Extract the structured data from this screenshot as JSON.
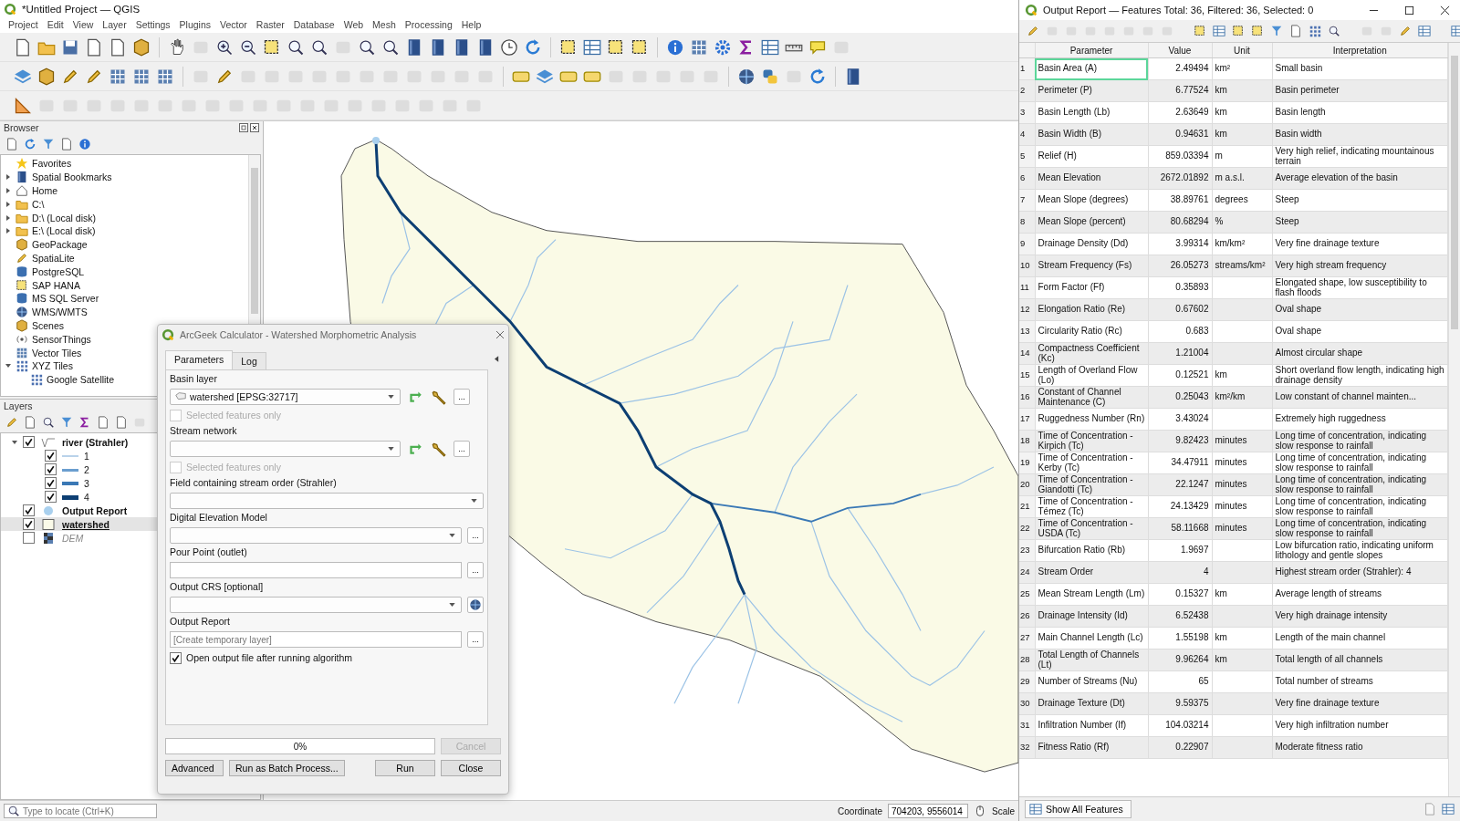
{
  "main_window": {
    "title": "*Untitled Project — QGIS",
    "menu": [
      "Project",
      "Edit",
      "View",
      "Layer",
      "Settings",
      "Plugins",
      "Vector",
      "Raster",
      "Database",
      "Web",
      "Mesh",
      "Processing",
      "Help"
    ]
  },
  "browser": {
    "title": "Browser",
    "items": [
      {
        "label": "Favorites"
      },
      {
        "label": "Spatial Bookmarks",
        "expanded": false
      },
      {
        "label": "Home",
        "expanded": false
      },
      {
        "label": "C:\\",
        "expanded": false
      },
      {
        "label": "D:\\ (Local disk)",
        "expanded": false
      },
      {
        "label": "E:\\ (Local disk)",
        "expanded": false
      },
      {
        "label": "GeoPackage"
      },
      {
        "label": "SpatiaLite"
      },
      {
        "label": "PostgreSQL"
      },
      {
        "label": "SAP HANA"
      },
      {
        "label": "MS SQL Server"
      },
      {
        "label": "WMS/WMTS"
      },
      {
        "label": "Scenes"
      },
      {
        "label": "SensorThings"
      },
      {
        "label": "Vector Tiles"
      },
      {
        "label": "XYZ Tiles",
        "expanded": true,
        "children": [
          {
            "label": "Google Satellite"
          }
        ]
      }
    ]
  },
  "layers": {
    "title": "Layers",
    "items": [
      {
        "label": "river (Strahler)",
        "kind": "line",
        "checked": true,
        "selected": false,
        "expanded": true,
        "children": [
          {
            "label": "1",
            "checked": true,
            "selected": false,
            "color": "#b9d3ea"
          },
          {
            "label": "2",
            "checked": true,
            "selected": false,
            "color": "#6a9ecf"
          },
          {
            "label": "3",
            "checked": true,
            "selected": false,
            "color": "#3a78b5"
          },
          {
            "label": "4",
            "checked": true,
            "selected": false,
            "color": "#0d3f73"
          }
        ]
      },
      {
        "label": "Output Report",
        "kind": "point",
        "checked": true,
        "selected": false
      },
      {
        "label": "watershed",
        "kind": "polygon",
        "checked": true,
        "selected": true
      },
      {
        "label": "DEM",
        "kind": "raster",
        "checked": false,
        "selected": false
      }
    ]
  },
  "dialog": {
    "title": "ArcGeek Calculator - Watershed Morphometric Analysis",
    "tabs": [
      {
        "label": "Parameters",
        "selected": true
      },
      {
        "label": "Log",
        "selected": false
      }
    ],
    "params": [
      {
        "kind": "label",
        "text": "Basin layer"
      },
      {
        "kind": "layer_select",
        "value": "watershed [EPSG:32717]",
        "button": "..."
      },
      {
        "kind": "checkbox",
        "label": "Selected features only",
        "checked": false,
        "disabled": true
      },
      {
        "kind": "label",
        "text": "Stream network"
      },
      {
        "kind": "layer_select",
        "button": "..."
      },
      {
        "kind": "checkbox",
        "label": "Selected features only",
        "checked": false,
        "disabled": true
      },
      {
        "kind": "label",
        "text": "Field containing stream order (Strahler)"
      },
      {
        "kind": "combo"
      },
      {
        "kind": "label",
        "text": "Digital Elevation Model"
      },
      {
        "kind": "combo_browse",
        "button": "..."
      },
      {
        "kind": "label",
        "text": "Pour Point (outlet)"
      },
      {
        "kind": "text_browse",
        "button": "..."
      },
      {
        "kind": "label",
        "text": "Output CRS [optional]"
      },
      {
        "kind": "crs_select"
      },
      {
        "kind": "label",
        "text": "Output Report"
      },
      {
        "kind": "text_browse",
        "placeholder": "[Create temporary layer]",
        "button": "..."
      },
      {
        "kind": "checkbox",
        "label": "Open output file after running algorithm",
        "checked": true,
        "disabled": false
      }
    ],
    "progress": {
      "text": "0%",
      "level": 0
    },
    "cancel": {
      "label": "Cancel",
      "disabled": true
    },
    "buttons": [
      {
        "label": "Advanced",
        "kind": "menu"
      },
      {
        "label": "Run as Batch Process...",
        "kind": "plain"
      },
      {
        "label": "Run",
        "kind": "plain"
      },
      {
        "label": "Close",
        "kind": "plain"
      }
    ]
  },
  "status_bar": {
    "locate_placeholder": "Type to locate (Ctrl+K)",
    "coordinate_label": "Coordinate",
    "coordinate": "704203, 9556014",
    "scale_label": "Scale"
  },
  "report": {
    "title": "Output Report — Features Total: 36, Filtered: 36, Selected: 0",
    "columns": [
      "Parameter",
      "Value",
      "Unit",
      "Interpretation"
    ],
    "rows": [
      {
        "n": "1",
        "parameter": "Basin Area (A)",
        "value": "2.49494",
        "unit": "km²",
        "interpretation": "Small basin",
        "selected": true
      },
      {
        "n": "2",
        "parameter": "Perimeter (P)",
        "value": "6.77524",
        "unit": "km",
        "interpretation": "Basin perimeter",
        "selected": false
      },
      {
        "n": "3",
        "parameter": "Basin Length (Lb)",
        "value": "2.63649",
        "unit": "km",
        "interpretation": "Basin length",
        "selected": false
      },
      {
        "n": "4",
        "parameter": "Basin Width (B)",
        "value": "0.94631",
        "unit": "km",
        "interpretation": "Basin width",
        "selected": false
      },
      {
        "n": "5",
        "parameter": "Relief (H)",
        "value": "859.03394",
        "unit": "m",
        "interpretation": "Very high relief, indicating mountainous terrain",
        "selected": false
      },
      {
        "n": "6",
        "parameter": "Mean Elevation",
        "value": "2672.01892",
        "unit": "m a.s.l.",
        "interpretation": "Average elevation of the basin",
        "selected": false
      },
      {
        "n": "7",
        "parameter": "Mean Slope (degrees)",
        "value": "38.89761",
        "unit": "degrees",
        "interpretation": "Steep",
        "selected": false
      },
      {
        "n": "8",
        "parameter": "Mean Slope (percent)",
        "value": "80.68294",
        "unit": "%",
        "interpretation": "Steep",
        "selected": false
      },
      {
        "n": "9",
        "parameter": "Drainage Density (Dd)",
        "value": "3.99314",
        "unit": "km/km²",
        "interpretation": "Very fine drainage texture",
        "selected": false
      },
      {
        "n": "10",
        "parameter": "Stream Frequency (Fs)",
        "value": "26.05273",
        "unit": "streams/km²",
        "interpretation": "Very high stream frequency",
        "selected": false
      },
      {
        "n": "11",
        "parameter": "Form Factor (Ff)",
        "value": "0.35893",
        "interpretation": "Elongated shape, low susceptibility to flash floods",
        "selected": false
      },
      {
        "n": "12",
        "parameter": "Elongation Ratio (Re)",
        "value": "0.67602",
        "interpretation": "Oval shape",
        "selected": false
      },
      {
        "n": "13",
        "parameter": "Circularity Ratio (Rc)",
        "value": "0.683",
        "interpretation": "Oval shape",
        "selected": false
      },
      {
        "n": "14",
        "parameter": "Compactness Coefficient (Kc)",
        "value": "1.21004",
        "interpretation": "Almost circular shape",
        "selected": false
      },
      {
        "n": "15",
        "parameter": "Length of Overland Flow (Lo)",
        "value": "0.12521",
        "unit": "km",
        "interpretation": "Short overland flow length, indicating high drainage density",
        "selected": false
      },
      {
        "n": "16",
        "parameter": "Constant of Channel Maintenance (C)",
        "value": "0.25043",
        "unit": "km²/km",
        "interpretation": "Low constant of channel mainten...",
        "selected": false
      },
      {
        "n": "17",
        "parameter": "Ruggedness Number (Rn)",
        "value": "3.43024",
        "interpretation": "Extremely high ruggedness",
        "selected": false
      },
      {
        "n": "18",
        "parameter": "Time of Concentration - Kirpich (Tc)",
        "value": "9.82423",
        "unit": "minutes",
        "interpretation": "Long time of concentration, indicating slow response to rainfall",
        "selected": false
      },
      {
        "n": "19",
        "parameter": "Time of Concentration - Kerby (Tc)",
        "value": "34.47911",
        "unit": "minutes",
        "interpretation": "Long time of concentration, indicating slow response to rainfall",
        "selected": false
      },
      {
        "n": "20",
        "parameter": "Time of Concentration - Giandotti (Tc)",
        "value": "22.1247",
        "unit": "minutes",
        "interpretation": "Long time of concentration, indicating slow response to rainfall",
        "selected": false
      },
      {
        "n": "21",
        "parameter": "Time of Concentration - Témez (Tc)",
        "value": "24.13429",
        "unit": "minutes",
        "interpretation": "Long time of concentration, indicating slow response to rainfall",
        "selected": false
      },
      {
        "n": "22",
        "parameter": "Time of Concentration - USDA (Tc)",
        "value": "58.11668",
        "unit": "minutes",
        "interpretation": "Long time of concentration, indicating slow response to rainfall",
        "selected": false
      },
      {
        "n": "23",
        "parameter": "Bifurcation Ratio (Rb)",
        "value": "1.9697",
        "interpretation": "Low bifurcation ratio, indicating uniform lithology and gentle slopes",
        "selected": false
      },
      {
        "n": "24",
        "parameter": "Stream Order",
        "value": "4",
        "interpretation": "Highest stream order (Strahler): 4",
        "selected": false
      },
      {
        "n": "25",
        "parameter": "Mean Stream Length (Lm)",
        "value": "0.15327",
        "unit": "km",
        "interpretation": "Average length of streams",
        "selected": false
      },
      {
        "n": "26",
        "parameter": "Drainage Intensity (Id)",
        "value": "6.52438",
        "interpretation": "Very high drainage intensity",
        "selected": false
      },
      {
        "n": "27",
        "parameter": "Main Channel Length (Lc)",
        "value": "1.55198",
        "unit": "km",
        "interpretation": "Length of the main channel",
        "selected": false
      },
      {
        "n": "28",
        "parameter": "Total Length of Channels (Lt)",
        "value": "9.96264",
        "unit": "km",
        "interpretation": "Total length of all channels",
        "selected": false
      },
      {
        "n": "29",
        "parameter": "Number of Streams (Nu)",
        "value": "65",
        "interpretation": "Total number of streams",
        "selected": false
      },
      {
        "n": "30",
        "parameter": "Drainage Texture (Dt)",
        "value": "9.59375",
        "interpretation": "Very fine drainage texture",
        "selected": false
      },
      {
        "n": "31",
        "parameter": "Infiltration Number (If)",
        "value": "104.03214",
        "interpretation": "Very high infiltration number",
        "selected": false
      },
      {
        "n": "32",
        "parameter": "Fitness Ratio (Rf)",
        "value": "0.22907",
        "interpretation": "Moderate fitness ratio",
        "selected": false
      }
    ],
    "show_button": "Show All Features"
  }
}
